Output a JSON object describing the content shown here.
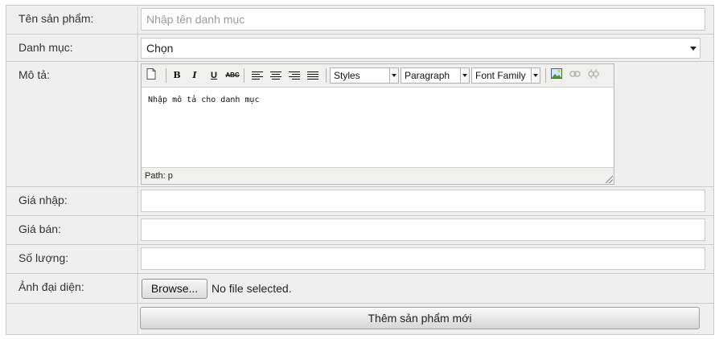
{
  "form": {
    "product_name": {
      "label": "Tên sản phẩm:",
      "placeholder": "Nhập tên danh mục",
      "value": ""
    },
    "category": {
      "label": "Danh mục:",
      "selected": "Chọn"
    },
    "description": {
      "label": "Mô tả:",
      "content": "Nhập mô tả cho danh mục",
      "path_label": "Path: p",
      "toolbar": {
        "new_document_icon": "new-document-icon",
        "bold": "B",
        "italic": "I",
        "underline": "U",
        "strikethrough": "ABC",
        "styles_select": "Styles",
        "paragraph_select": "Paragraph",
        "font_family_select": "Font Family",
        "insert_image_icon": "insert-image-icon",
        "link_icon": "link-icon",
        "unlink_icon": "unlink-icon"
      }
    },
    "import_price": {
      "label": "Giá nhập:",
      "value": ""
    },
    "sale_price": {
      "label": "Giá bán:",
      "value": ""
    },
    "quantity": {
      "label": "Số lượng:",
      "value": ""
    },
    "avatar": {
      "label": "Ảnh đại diện:",
      "browse_label": "Browse...",
      "file_status": "No file selected."
    },
    "submit_label": "Thêm sản phẩm mới"
  }
}
